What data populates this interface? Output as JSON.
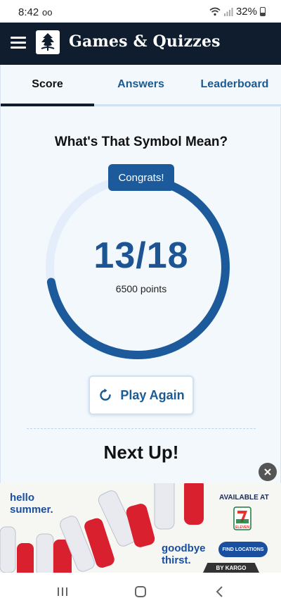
{
  "status_bar": {
    "time": "8:42",
    "voicemail": "oo",
    "battery_percent": "32%"
  },
  "app_bar": {
    "title": "Games & Quizzes",
    "menu_icon": "hamburger-menu-icon",
    "logo_icon": "britannica-thistle-logo"
  },
  "tabs": [
    {
      "label": "Score",
      "active": true
    },
    {
      "label": "Answers",
      "active": false
    },
    {
      "label": "Leaderboard",
      "active": false
    }
  ],
  "quiz": {
    "title": "What's That Symbol Mean?",
    "badge": "Congrats!",
    "score": "13/18",
    "correct": 13,
    "total": 18,
    "points": "6500 points"
  },
  "actions": {
    "play_again": "Play Again",
    "play_again_icon": "refresh-icon"
  },
  "next_up": {
    "heading": "Next Up!"
  },
  "ad": {
    "headline": "hello summer.",
    "available_at": "AVAILABLE AT",
    "store": "ELEVEN",
    "tagline": "goodbye thirst.",
    "cta": "FIND LOCATIONS",
    "provider": "BY KARGO",
    "close_icon": "close-icon"
  },
  "colors": {
    "brand_navy": "#0f1d2e",
    "accent_blue": "#1c5a9c",
    "ring_track": "#e3eefa"
  }
}
